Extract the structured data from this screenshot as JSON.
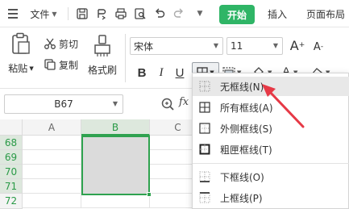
{
  "menubar": {
    "file_label": "文件",
    "tabs": [
      "开始",
      "插入",
      "页面布局"
    ],
    "accent_color": "#2fb566"
  },
  "ribbon": {
    "paste_label": "粘贴",
    "cut_label": "剪切",
    "copy_label": "复制",
    "format_painter_label": "格式刷",
    "font_name": "宋体",
    "font_size": "11",
    "grow_font": "A",
    "shrink_font": "A",
    "bold": "B",
    "italic": "I",
    "underline": "U",
    "font_color_letter": "A",
    "highlight_color": "#f5c518",
    "font_color": "#e02020"
  },
  "formula_bar": {
    "cell_ref": "B67",
    "fx": "fx"
  },
  "grid": {
    "columns": [
      "A",
      "B",
      "C"
    ],
    "rows": [
      "68",
      "69",
      "70",
      "71",
      "72"
    ],
    "selected_column": "B",
    "selection_color": "#2fa24f"
  },
  "border_menu": {
    "items": [
      {
        "label": "无框线(N)",
        "icon": "no-border-icon"
      },
      {
        "label": "所有框线(A)",
        "icon": "all-borders-icon"
      },
      {
        "label": "外侧框线(S)",
        "icon": "outside-borders-icon"
      },
      {
        "label": "粗匣框线(T)",
        "icon": "thick-box-border-icon"
      },
      {
        "label": "下框线(O)",
        "icon": "bottom-border-icon"
      },
      {
        "label": "上框线(P)",
        "icon": "top-border-icon"
      }
    ],
    "annotation_arrow_color": "#e63946"
  }
}
